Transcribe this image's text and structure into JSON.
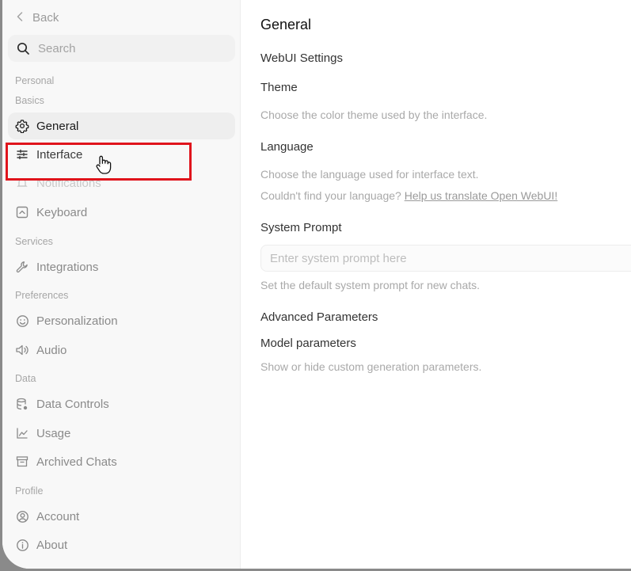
{
  "sidebar": {
    "back_label": "Back",
    "search_placeholder": "Search",
    "sections": {
      "personal": "Personal",
      "basics": "Basics",
      "services": "Services",
      "preferences": "Preferences",
      "data": "Data",
      "profile": "Profile"
    },
    "items": {
      "general": "General",
      "interface": "Interface",
      "notifications": "Notifications",
      "keyboard": "Keyboard",
      "integrations": "Integrations",
      "personalization": "Personalization",
      "audio": "Audio",
      "data_controls": "Data Controls",
      "usage": "Usage",
      "archived_chats": "Archived Chats",
      "account": "Account",
      "about": "About"
    },
    "active_item": "General"
  },
  "main": {
    "title": "General",
    "webui_settings": "WebUI Settings",
    "theme": {
      "label": "Theme",
      "description": "Choose the color theme used by the interface."
    },
    "language": {
      "label": "Language",
      "description": "Choose the language used for interface text.",
      "help_prefix": "Couldn't find your language?",
      "help_link": "Help us translate Open WebUI!"
    },
    "system_prompt": {
      "label": "System Prompt",
      "placeholder": "Enter system prompt here",
      "description": "Set the default system prompt for new chats."
    },
    "advanced": {
      "label": "Advanced Parameters",
      "model_params": "Model parameters",
      "model_params_description": "Show or hide custom generation parameters."
    }
  },
  "colors": {
    "highlight": "#e0141c",
    "active_bg": "#eeeeee",
    "sidebar_bg": "#f8f8f8"
  }
}
